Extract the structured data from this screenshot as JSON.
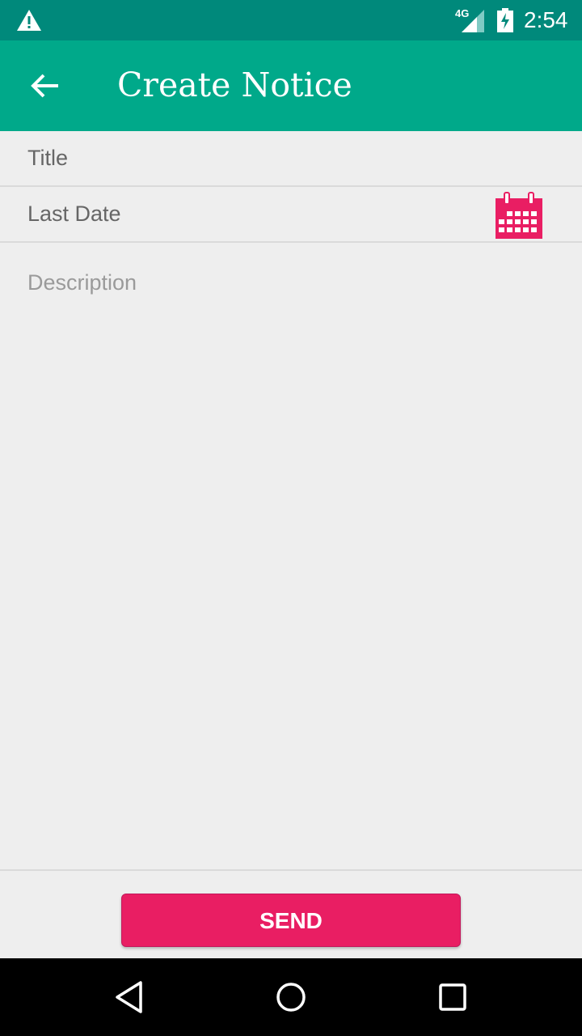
{
  "status_bar": {
    "network": "4G",
    "time": "2:54"
  },
  "app_bar": {
    "title": "Create Notice"
  },
  "form": {
    "title_placeholder": "Title",
    "last_date_placeholder": "Last Date",
    "description_placeholder": "Description"
  },
  "actions": {
    "send_label": "SEND"
  },
  "colors": {
    "status_bar": "#00897b",
    "app_bar": "#00a98a",
    "accent": "#e91e63",
    "background": "#eeeeee"
  },
  "icons": [
    "warning-icon",
    "signal-icon",
    "battery-charging-icon",
    "back-arrow-icon",
    "calendar-icon",
    "nav-back-icon",
    "nav-home-icon",
    "nav-recents-icon"
  ]
}
